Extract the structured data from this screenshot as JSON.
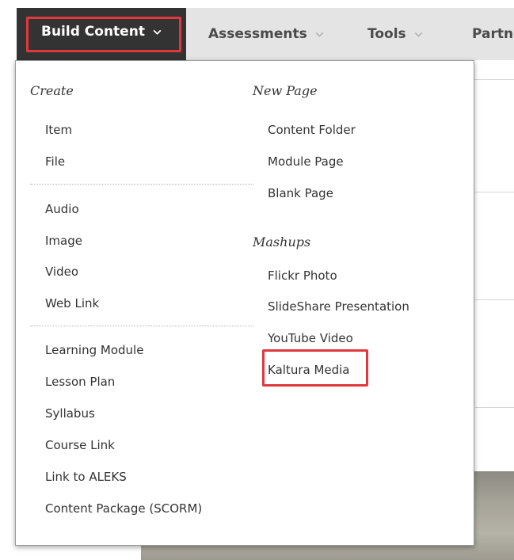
{
  "toolbar": {
    "build_content": "Build Content",
    "assessments": "Assessments",
    "tools": "Tools",
    "partner": "Partne"
  },
  "menu": {
    "create": {
      "heading": "Create",
      "items": [
        "Item",
        "File",
        "Audio",
        "Image",
        "Video",
        "Web Link",
        "Learning Module",
        "Lesson Plan",
        "Syllabus",
        "Course Link",
        "Link to ALEKS",
        "Content Package (SCORM)"
      ]
    },
    "new_page": {
      "heading": "New Page",
      "items": [
        "Content Folder",
        "Module Page",
        "Blank Page"
      ]
    },
    "mashups": {
      "heading": "Mashups",
      "items": [
        "Flickr Photo",
        "SlideShare Presentation",
        "YouTube Video",
        "Kaltura Media"
      ]
    }
  },
  "colors": {
    "active_tab_bg": "#333333",
    "toolbar_bg": "#e4e4e4",
    "highlight_red": "#e0383e"
  },
  "icons": {
    "dropdown": "chevron-down-icon"
  }
}
